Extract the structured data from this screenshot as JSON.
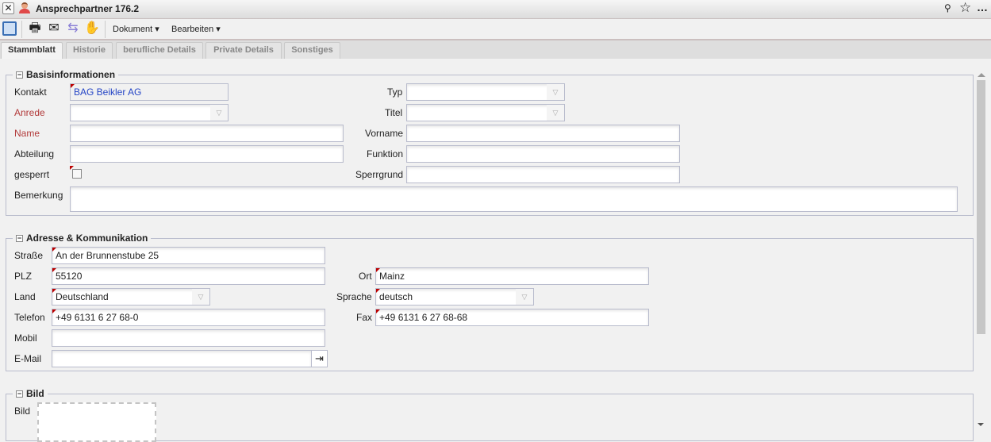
{
  "window": {
    "title": "Ansprechpartner 176.2"
  },
  "toolbar": {
    "menus": [
      "Dokument ▾",
      "Bearbeiten ▾"
    ]
  },
  "tabs": [
    "Stammblatt",
    "Historie",
    "berufliche Details",
    "Private Details",
    "Sonstiges"
  ],
  "basis": {
    "legend": "Basisinformationen",
    "kontakt_label": "Kontakt",
    "kontakt_value": "BAG Beikler AG",
    "anrede_label": "Anrede",
    "anrede_value": "",
    "name_label": "Name",
    "name_value": "",
    "abteilung_label": "Abteilung",
    "abteilung_value": "",
    "gesperrt_label": "gesperrt",
    "bemerkung_label": "Bemerkung",
    "bemerkung_value": "",
    "typ_label": "Typ",
    "typ_value": "",
    "titel_label": "Titel",
    "titel_value": "",
    "vorname_label": "Vorname",
    "vorname_value": "",
    "funktion_label": "Funktion",
    "funktion_value": "",
    "sperrgrund_label": "Sperrgrund",
    "sperrgrund_value": ""
  },
  "adresse": {
    "legend": "Adresse & Kommunikation",
    "strasse_label": "Straße",
    "strasse_value": "An der Brunnenstube 25",
    "plz_label": "PLZ",
    "plz_value": "55120",
    "land_label": "Land",
    "land_value": "Deutschland",
    "telefon_label": "Telefon",
    "telefon_value": "+49 6131 6 27 68-0",
    "mobil_label": "Mobil",
    "mobil_value": "",
    "email_label": "E-Mail",
    "email_value": "",
    "ort_label": "Ort",
    "ort_value": "Mainz",
    "sprache_label": "Sprache",
    "sprache_value": "deutsch",
    "fax_label": "Fax",
    "fax_value": "+49 6131 6 27 68-68"
  },
  "bild": {
    "legend": "Bild",
    "label": "Bild"
  }
}
